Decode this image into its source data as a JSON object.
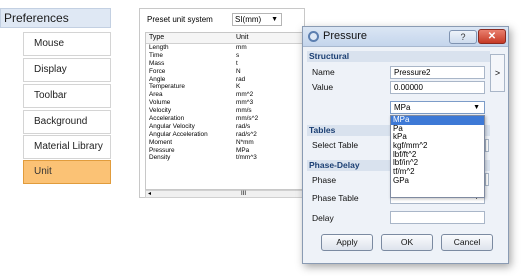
{
  "sidebar": {
    "title": "Preferences",
    "items": [
      {
        "label": "Mouse"
      },
      {
        "label": "Display"
      },
      {
        "label": "Toolbar"
      },
      {
        "label": "Background"
      },
      {
        "label": "Material Library"
      },
      {
        "label": "Unit",
        "active": true
      }
    ]
  },
  "unit_panel": {
    "preset_label": "Preset unit system",
    "preset_value": "SI(mm)",
    "columns": [
      "Type",
      "Unit"
    ],
    "rows": [
      {
        "type": "Length",
        "unit": "mm"
      },
      {
        "type": "Time",
        "unit": "s"
      },
      {
        "type": "Mass",
        "unit": "t"
      },
      {
        "type": "Force",
        "unit": "N"
      },
      {
        "type": "Angle",
        "unit": "rad"
      },
      {
        "type": "Temperature",
        "unit": "K"
      },
      {
        "type": "Area",
        "unit": "mm^2"
      },
      {
        "type": "Volume",
        "unit": "mm^3"
      },
      {
        "type": "Velocity",
        "unit": "mm/s"
      },
      {
        "type": "Acceleration",
        "unit": "mm/s^2"
      },
      {
        "type": "Angular Velocity",
        "unit": "rad/s"
      },
      {
        "type": "Angular Acceleration",
        "unit": "rad/s^2"
      },
      {
        "type": "Moment",
        "unit": "N*mm"
      },
      {
        "type": "Pressure",
        "unit": "MPa"
      },
      {
        "type": "Density",
        "unit": "t/mm^3"
      }
    ],
    "scrollbar_mark": "III",
    "scroll_left_arrow": "◂"
  },
  "dialog": {
    "title": "Pressure",
    "help_label": "?",
    "close_label": "✕",
    "expander_label": ">",
    "sections": {
      "structural": "Structural",
      "tables": "Tables",
      "phase_delay": "Phase-Delay"
    },
    "fields": {
      "name_label": "Name",
      "name_value": "Pressure2",
      "value_label": "Value",
      "value_value": "0.00000",
      "unit_selected": "MPa",
      "select_table_label": "Select Table",
      "phase_label": "Phase",
      "phase_table_label": "Phase Table",
      "delay_label": "Delay"
    },
    "unit_options": [
      "MPa",
      "Pa",
      "kPa",
      "kgf/mm^2",
      "lbf/ft^2",
      "lbf/in^2",
      "tf/m^2",
      "GPa"
    ],
    "buttons": {
      "apply": "Apply",
      "ok": "OK",
      "cancel": "Cancel"
    }
  }
}
